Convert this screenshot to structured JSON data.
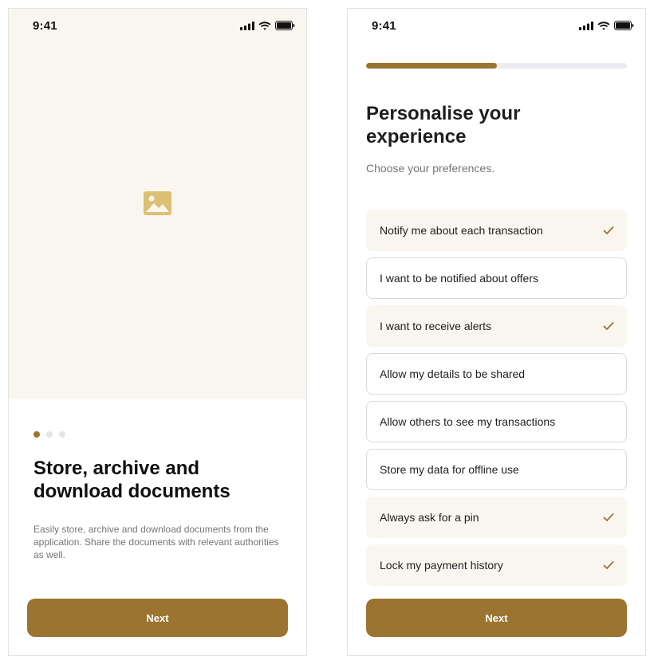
{
  "status_bar": {
    "time": "9:41"
  },
  "onboarding": {
    "hero_icon": "image-placeholder-icon",
    "pagination": {
      "total": 3,
      "active": 1
    },
    "title": "Store, archive and download documents",
    "description": "Easily store, archive and download documents from the application. Share the documents with relevant authorities as well.",
    "next_label": "Next"
  },
  "preferences": {
    "progress": 0.5,
    "title": "Personalise your experience",
    "subtitle": "Choose your preferences.",
    "options": [
      {
        "label": "Notify me about each transaction",
        "selected": true
      },
      {
        "label": "I want to be notified about offers",
        "selected": false
      },
      {
        "label": "I want to receive alerts",
        "selected": true
      },
      {
        "label": "Allow my details to be shared",
        "selected": false
      },
      {
        "label": "Allow others to see my transactions",
        "selected": false
      },
      {
        "label": "Store my data for offline use",
        "selected": false
      },
      {
        "label": "Always ask for a pin",
        "selected": true
      },
      {
        "label": "Lock my payment history",
        "selected": true
      }
    ],
    "next_label": "Next"
  },
  "colors": {
    "accent": "#9a7430",
    "hero_bg": "#f9f6ef",
    "selected_bg": "#f9f6ef",
    "placeholder_icon": "#dcc074",
    "muted_text": "#757575"
  }
}
